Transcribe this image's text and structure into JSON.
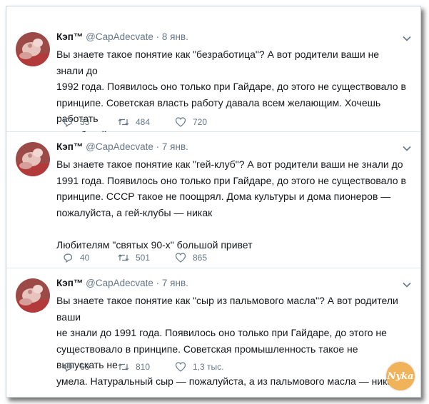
{
  "tweets": [
    {
      "name": "Кэп™",
      "handle": "@CapAdecvate",
      "sep": "·",
      "date": "8 янв.",
      "text": "Вы знаете такое понятие как \"безработица\"? А вот родители ваши не знали до\n1992 года. Появилось оно только при Гайдаре, до этого не существовало в\nпринципе. Советская власть работу давала всем желающим. Хочешь работать\n— работай, а не хочешь — статья за тунеядство.",
      "replies": "33",
      "retweets": "484",
      "likes": "720"
    },
    {
      "name": "Кэп™",
      "handle": "@CapAdecvate",
      "sep": "·",
      "date": "7 янв.",
      "text": "Вы знаете такое понятие как \"гей-клуб\"? А вот родители ваши не знали до\n1991 года. Появилось оно только при Гайдаре, до этого не существовало в\nпринципе. СССР такое не поощрял. Дома культуры и дома пионеров —\nпожалуйста, а гей-клубы — никак\n\nЛюбителям \"святых 90-х\" большой привет",
      "replies": "40",
      "retweets": "501",
      "likes": "865"
    },
    {
      "name": "Кэп™",
      "handle": "@CapAdecvate",
      "sep": "·",
      "date": "7 янв.",
      "text": "Вы знаете такое понятие как \"сыр из пальмового масла\"? А вот родители ваши\nне знали до 1991 года. Появилось оно только при Гайдаре, до этого не\nсуществовало в принципе. Советская промышленность такое не выпускать не\nумела. Натуральный сыр — пожалуйста, а из пальмового масла — никак.",
      "replies": "68",
      "retweets": "810",
      "likes": "1,3 тыс."
    }
  ],
  "watermark": "Nyka",
  "icons": {
    "reply": "reply-icon",
    "retweet": "retweet-icon",
    "like": "heart-icon",
    "more": "chevron-down-icon"
  },
  "colors": {
    "text": "#14171a",
    "secondary": "#657786",
    "border": "#e1e8ed",
    "watermark": "#f0b35a"
  }
}
